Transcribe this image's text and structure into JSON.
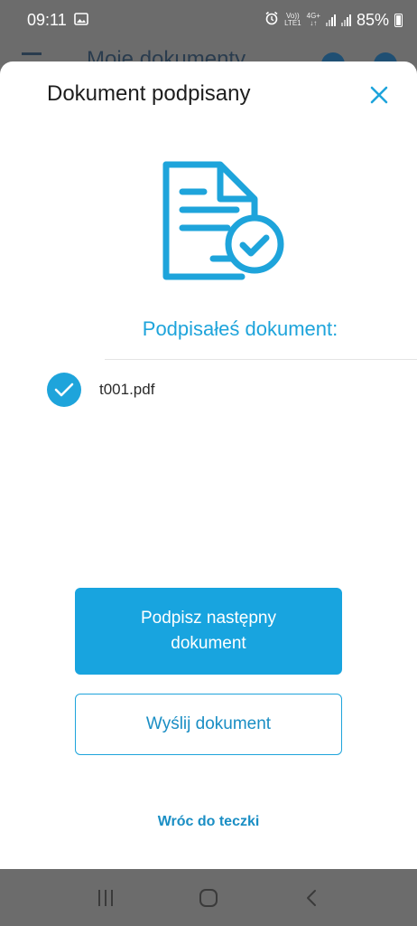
{
  "status_bar": {
    "time": "09:11",
    "volte_top": "Vo))",
    "volte_bottom": "LTE1",
    "network_top": "4G+",
    "network_bottom": "↓↑",
    "battery": "85%"
  },
  "background_app": {
    "title": "Moje dokumenty"
  },
  "modal": {
    "title": "Dokument podpisany",
    "signed_heading": "Podpisałeś dokument:",
    "files": [
      {
        "name": "t001.pdf"
      }
    ],
    "primary_button": "Podpisz następny dokument",
    "secondary_button": "Wyślij dokument",
    "back_link": "Wróc do teczki"
  },
  "colors": {
    "accent": "#1ea4db",
    "primary_button": "#18a4df",
    "overlay": "#6c6c6c"
  },
  "icons": {
    "close": "close-icon",
    "illustration": "document-check-icon",
    "file_status": "check-circle-icon"
  }
}
